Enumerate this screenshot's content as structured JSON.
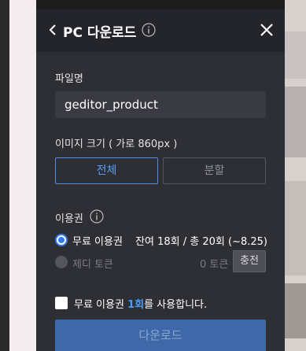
{
  "header": {
    "title": "PC 다운로드"
  },
  "filename": {
    "label": "파일명",
    "value": "geditor_product"
  },
  "image_size": {
    "label": "이미지 크기 ( 가로 860px )",
    "options": [
      "전체",
      "분할"
    ],
    "selected": "전체"
  },
  "license": {
    "label": "이용권",
    "free_option": "무료 이용권",
    "remaining": "잔여 18회 / 총 20회 (~8.25)",
    "token_option": "제디 토큰",
    "token_count": "0 토큰",
    "charge_button": "충전"
  },
  "agreement": {
    "prefix": "무료 이용권 ",
    "highlight": "1회",
    "suffix": "를 사용합니다.",
    "checked": false
  },
  "download_button": "다운로드",
  "colors": {
    "panel_bg": "#2e2f35",
    "accent": "#2f7cf0",
    "download_bg": "#3f68a8"
  },
  "icons": [
    "chevron-left-icon",
    "info-icon",
    "close-icon"
  ]
}
